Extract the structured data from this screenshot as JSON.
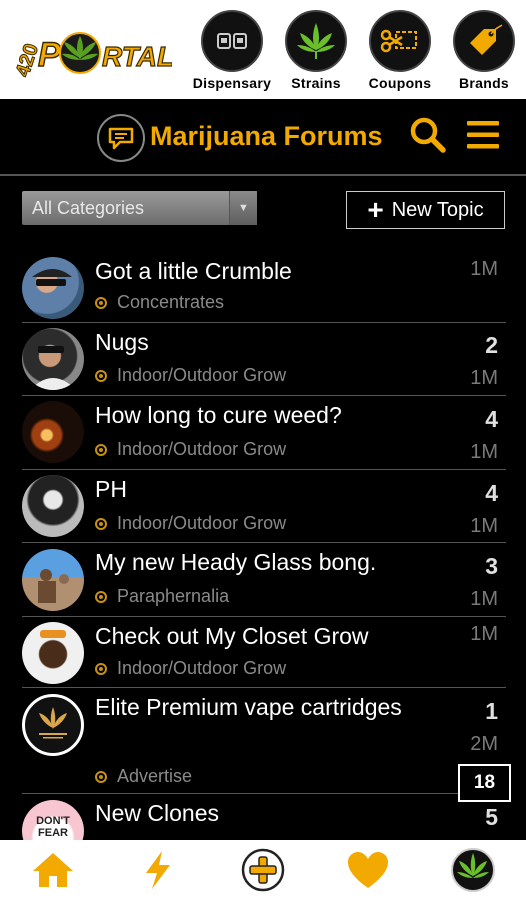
{
  "colors": {
    "accent": "#f2a900",
    "background": "#000000",
    "header_bg": "#ffffff",
    "muted": "#8a8a8a"
  },
  "brand": {
    "logo_text": "420PORTAL",
    "logo_icon": "cannabis-leaf-logo-icon"
  },
  "top_nav": [
    {
      "label": "Dispensary",
      "icon": "dispensary-icon"
    },
    {
      "label": "Strains",
      "icon": "leaf-icon"
    },
    {
      "label": "Coupons",
      "icon": "scissors-coupon-icon"
    },
    {
      "label": "Brands",
      "icon": "tag-icon"
    }
  ],
  "forum_bar": {
    "title": "Marijuana Forums",
    "icon": "chat-bubble-icon",
    "search_icon": "search-icon",
    "menu_icon": "hamburger-menu-icon"
  },
  "controls": {
    "category_select": "All Categories",
    "new_topic_label": "New Topic"
  },
  "topics": [
    {
      "title": "Got a little Crumble",
      "category": "Concentrates",
      "replies": "",
      "age": "1M"
    },
    {
      "title": "Nugs",
      "category": "Indoor/Outdoor Grow",
      "replies": "2",
      "age": "1M"
    },
    {
      "title": "How long to cure weed?",
      "category": "Indoor/Outdoor Grow",
      "replies": "4",
      "age": "1M"
    },
    {
      "title": "PH",
      "category": "Indoor/Outdoor Grow",
      "replies": "4",
      "age": "1M"
    },
    {
      "title": "My new Heady Glass bong.",
      "category": "Paraphernalia",
      "replies": "3",
      "age": "1M"
    },
    {
      "title": "Check out My Closet Grow",
      "category": "Indoor/Outdoor Grow",
      "replies": "",
      "age": "1M"
    },
    {
      "title": "Elite Premium vape cartridges",
      "category": "Advertise",
      "replies": "1",
      "age": "2M"
    },
    {
      "title": "New Clones",
      "category": "",
      "replies": "5",
      "age": ""
    }
  ],
  "page_badge": "18",
  "bottom_nav": [
    {
      "icon": "home-icon"
    },
    {
      "icon": "lightning-icon"
    },
    {
      "icon": "plus-circle-icon"
    },
    {
      "icon": "heart-icon"
    },
    {
      "icon": "profile-leaf-icon"
    }
  ]
}
